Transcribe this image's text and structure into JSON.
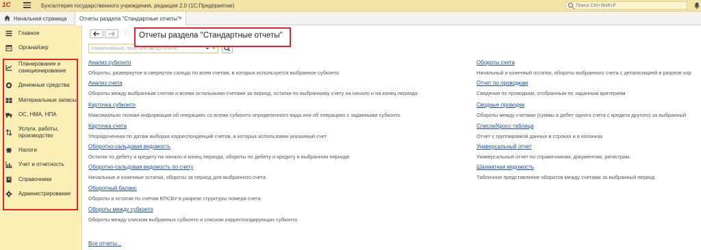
{
  "titlebar": {
    "logo": "1С",
    "app_title": "Бухгалтерия государственного учреждения, редакция 2.0  (1С:Предприятие)",
    "search_placeholder": "Поиск Ctrl+Shift+F",
    "colors": {
      "background": "#f3e3a5",
      "logo": "#d12a2a"
    }
  },
  "tabs": {
    "home_label": "Начальная страница",
    "active_label": "Отчеты раздела \"Стандартные отчеты\"",
    "close_glyph": "×"
  },
  "sidebar": {
    "items": [
      {
        "label": "Главное",
        "icon": "hamburger-icon"
      },
      {
        "label": "Органайзер",
        "icon": "calendar-icon"
      },
      {
        "label": "Планирование и санкционирование",
        "icon": "chart-icon"
      },
      {
        "label": "Денежные средства",
        "icon": "coin-icon"
      },
      {
        "label": "Материальные запасы",
        "icon": "warehouse-icon"
      },
      {
        "label": "ОС, НМА, НПА",
        "icon": "truck-icon"
      },
      {
        "label": "Услуги, работы, производство",
        "icon": "transfer-icon"
      },
      {
        "label": "Налоги",
        "icon": "emblem-icon"
      },
      {
        "label": "Учет и отчетность",
        "icon": "bar-chart-icon"
      },
      {
        "label": "Справочники",
        "icon": "book-icon"
      },
      {
        "label": "Администрирование",
        "icon": "gear-icon"
      }
    ],
    "colors": {
      "background": "#fbefb6",
      "highlight_frame": "#e8202a"
    }
  },
  "content": {
    "title": "Отчеты раздела \"Стандартные отчеты\"",
    "filter_placeholder": "Наименование, поле или автор отчета",
    "clear_glyph": "×",
    "reports_left": [
      {
        "name": "Анализ субконто",
        "description": "Обороты, развернутое и свернутое сальдо по всем счетам, в которых используется выбранное субконто"
      },
      {
        "name": "Анализ счета",
        "description": "Обороты между выбранным счетом и всеми остальными счетами за период, остатки по выбранному счету на начало и на конец периода"
      },
      {
        "name": "Карточка субконто",
        "description": "Максимально полная информация об операциях со всеми субконто определенного вида или об операциях с заданными субконто"
      },
      {
        "name": "Карточка счета",
        "description": "Упорядоченная по датам выборка корреспонденций счетов, в которых использован указанный счет"
      },
      {
        "name": "Оборотно-сальдовая ведомость",
        "description": "Остатки по дебету и кредиту на начало и конец периода, обороты по дебету и кредиту в выбранном периоде"
      },
      {
        "name": "Оборотно-сальдовая ведомость по счету",
        "description": "Начальные и конечные остатки, обороты за период для выбранного счета"
      },
      {
        "name": "Оборотный баланс",
        "description": "Обороты и остатки по счетам ЕПСБУ в разрезе структуры номера счета"
      },
      {
        "name": "Обороты между субконто",
        "description": "Обороты между списком выбранных субконто и списком корреспондирующих субконто"
      }
    ],
    "reports_right": [
      {
        "name": "Обороты счета",
        "description": "Начальный и конечный остатки, обороты выбранного счета с детализацией в разрезе кор"
      },
      {
        "name": "Отчет по проводкам",
        "description": "Сведения по проводкам, отобранным по заданным критериям"
      },
      {
        "name": "Сводные проводки",
        "description": "Обороты между счетами (суммы в дебет одного счета с кредита другого) за выбранный"
      },
      {
        "name": "Список/Кросс-таблица",
        "description": "Отчет с группировкой данных в строках и в колонках"
      },
      {
        "name": "Универсальный отчет",
        "description": "Универсальный отчет по справочникам, документам, регистрам."
      },
      {
        "name": "Шахматная ведомость",
        "description": "Табличное представление оборотов между счетами за выбранный период"
      }
    ],
    "all_reports_label": "Все отчеты...",
    "colors": {
      "link": "#1a4f9c",
      "title_frame": "#e8202a",
      "filter_border": "#e6c36a"
    }
  }
}
